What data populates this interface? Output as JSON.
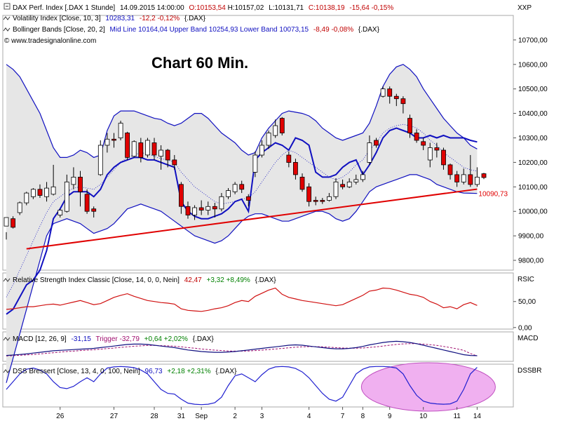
{
  "header": {
    "line1": {
      "icon": "minus-box-icon",
      "name": "DAX Perf. Index [.DAX  1 Stunde]",
      "datetime": "14.09.2015 14:00:00",
      "open": "O:10153,54",
      "high": "H:10157,02",
      "low": "L:10131,71",
      "close": "C:10138,19",
      "change": "-15,64 -0,15%"
    },
    "line2": {
      "icon": "indicator-icon",
      "name": "Volatility Index [Close, 10, 3]",
      "value": "10283,31",
      "change": "-12,2 -0,12%",
      "symbol": "{.DAX}"
    },
    "line3": {
      "icon": "indicator-icon",
      "name": "Bollinger Bands [Close, 20, 2]",
      "bands": "Mid Line 10164,04 Upper Band 10254,93 Lower Band 10073,15",
      "change": "-8,49 -0,08%",
      "symbol": "{.DAX}"
    },
    "copyright": "© www.tradesignalonline.com"
  },
  "chart_title": "Chart 60 Min.",
  "colors": {
    "up_candle": "#ffffff",
    "down_candle": "#e00000",
    "bollinger_line": "#1010c0",
    "band_fill": "#e6e6e6",
    "trendline": "#e00000",
    "rsi": "#d01010",
    "macd": "#101080",
    "trigger": "#a01070",
    "dss": "#2020d0",
    "highlight": "#f0b0f0"
  },
  "chart_data": [
    {
      "type": "candlestick",
      "axis_label": "XXP",
      "y_ticks": [
        "9800,00",
        "9900,00",
        "10000,00",
        "10100,00",
        "10200,00",
        "10300,00",
        "10400,00",
        "10500,00",
        "10600,00",
        "10700,00"
      ],
      "ylim": [
        9760,
        10800
      ],
      "x_labels": [
        "26",
        "27",
        "28",
        "31",
        "Sep",
        "2",
        "3",
        "4",
        "7",
        "8",
        "9",
        "10",
        "11",
        "14"
      ],
      "candles": [
        [
          9940,
          9975,
          9915,
          9885
        ],
        [
          9970,
          9935,
          9980,
          9930
        ],
        [
          9995,
          10035,
          10040,
          9985
        ],
        [
          10035,
          10075,
          10080,
          10025
        ],
        [
          10060,
          10090,
          10095,
          10050
        ],
        [
          10090,
          10065,
          10110,
          10055
        ],
        [
          10060,
          10095,
          10120,
          10040
        ],
        [
          10070,
          10100,
          10190,
          10065
        ],
        [
          9985,
          10005,
          10010,
          9975
        ],
        [
          10000,
          10120,
          10150,
          9995
        ],
        [
          10110,
          10140,
          10180,
          10090
        ],
        [
          10140,
          10080,
          10165,
          10020
        ],
        [
          10070,
          10000,
          10090,
          9990
        ],
        [
          10010,
          10000,
          10020,
          9975
        ],
        [
          10150,
          10270,
          10290,
          10145
        ],
        [
          10270,
          10295,
          10320,
          10240
        ],
        [
          10295,
          10290,
          10320,
          10260
        ],
        [
          10300,
          10360,
          10370,
          10290
        ],
        [
          10320,
          10220,
          10325,
          10210
        ],
        [
          10225,
          10285,
          10290,
          10220
        ],
        [
          10280,
          10220,
          10300,
          10200
        ],
        [
          10230,
          10290,
          10300,
          10220
        ],
        [
          10280,
          10230,
          10300,
          10210
        ],
        [
          10225,
          10250,
          10270,
          10170
        ],
        [
          10250,
          10210,
          10255,
          10180
        ],
        [
          10210,
          10190,
          10230,
          10170
        ],
        [
          10110,
          10020,
          10120,
          9990
        ],
        [
          10020,
          9985,
          10040,
          9970
        ],
        [
          9985,
          10015,
          10025,
          9965
        ],
        [
          10015,
          10005,
          10045,
          9985
        ],
        [
          10005,
          10020,
          10040,
          9985
        ],
        [
          10020,
          10010,
          10035,
          9975
        ],
        [
          10010,
          10060,
          10075,
          10000
        ],
        [
          10060,
          10085,
          10095,
          10050
        ],
        [
          10080,
          10110,
          10120,
          10070
        ],
        [
          10110,
          10090,
          10125,
          10075
        ],
        [
          10060,
          10045,
          10070,
          10020
        ],
        [
          10160,
          10230,
          10245,
          10140
        ],
        [
          10230,
          10270,
          10290,
          10220
        ],
        [
          10270,
          10320,
          10330,
          10255
        ],
        [
          10310,
          10350,
          10375,
          10300
        ],
        [
          10380,
          10320,
          10385,
          10310
        ],
        [
          10230,
          10200,
          10245,
          10180
        ],
        [
          10200,
          10150,
          10215,
          10130
        ],
        [
          10140,
          10090,
          10155,
          10080
        ],
        [
          10100,
          10040,
          10115,
          10020
        ],
        [
          10045,
          10040,
          10060,
          10025
        ],
        [
          10045,
          10040,
          10055,
          10030
        ],
        [
          10045,
          10060,
          10075,
          10040
        ],
        [
          10060,
          10120,
          10135,
          10050
        ],
        [
          10110,
          10100,
          10130,
          10090
        ],
        [
          10100,
          10120,
          10135,
          10095
        ],
        [
          10120,
          10130,
          10150,
          10110
        ],
        [
          10130,
          10150,
          10165,
          10120
        ],
        [
          10200,
          10280,
          10310,
          10190
        ],
        [
          10290,
          10270,
          10300,
          10260
        ],
        [
          10470,
          10500,
          10510,
          10465
        ],
        [
          10500,
          10470,
          10510,
          10440
        ],
        [
          10470,
          10460,
          10480,
          10430
        ],
        [
          10460,
          10440,
          10470,
          10400
        ],
        [
          10380,
          10320,
          10395,
          10300
        ],
        [
          10320,
          10290,
          10335,
          10280
        ],
        [
          10285,
          10270,
          10300,
          10250
        ],
        [
          10210,
          10260,
          10280,
          10180
        ],
        [
          10260,
          10250,
          10280,
          10220
        ],
        [
          10250,
          10190,
          10260,
          10170
        ],
        [
          10190,
          10150,
          10195,
          10130
        ],
        [
          10150,
          10120,
          10165,
          10100
        ],
        [
          10120,
          10150,
          10175,
          10110
        ],
        [
          10150,
          10110,
          10230,
          10100
        ],
        [
          10110,
          10140,
          10180,
          10100
        ],
        [
          10153.54,
          10138.19,
          10157.02,
          10131.71
        ]
      ],
      "trendline": {
        "from": [
          3,
          9847
        ],
        "to": [
          70,
          10090.73
        ],
        "label": "10090,73"
      },
      "bollinger": {
        "mid": [
          9650,
          9700,
          9760,
          9820,
          9880,
          9940,
          9995,
          10040,
          10060,
          10080,
          10095,
          10100,
          10095,
          10090,
          10110,
          10140,
          10170,
          10200,
          10220,
          10230,
          10240,
          10235,
          10225,
          10215,
          10210,
          10200,
          10160,
          10130,
          10100,
          10080,
          10060,
          10040,
          10030,
          10035,
          10040,
          10050,
          10055,
          10080,
          10120,
          10160,
          10200,
          10230,
          10250,
          10240,
          10220,
          10200,
          10180,
          10160,
          10140,
          10130,
          10140,
          10160,
          10190,
          10210,
          10250,
          10280,
          10320,
          10340,
          10350,
          10355,
          10350,
          10340,
          10320,
          10290,
          10270,
          10240,
          10220,
          10200,
          10180,
          10170,
          10164
        ],
        "upper": [
          10600,
          10580,
          10550,
          10500,
          10450,
          10400,
          10330,
          10260,
          10220,
          10220,
          10230,
          10250,
          10240,
          10220,
          10230,
          10330,
          10390,
          10410,
          10410,
          10410,
          10400,
          10390,
          10380,
          10375,
          10360,
          10350,
          10360,
          10380,
          10400,
          10400,
          10380,
          10350,
          10320,
          10300,
          10280,
          10250,
          10230,
          10240,
          10300,
          10340,
          10370,
          10400,
          10410,
          10405,
          10400,
          10390,
          10370,
          10340,
          10320,
          10300,
          10290,
          10300,
          10310,
          10320,
          10360,
          10430,
          10510,
          10560,
          10590,
          10600,
          10580,
          10550,
          10500,
          10460,
          10420,
          10380,
          10350,
          10320,
          10300,
          10270,
          10254.93
        ],
        "lower": [
          9300,
          9400,
          9500,
          9600,
          9700,
          9800,
          9900,
          9950,
          9960,
          9970,
          9960,
          9950,
          9930,
          9910,
          9920,
          9930,
          9950,
          9980,
          10010,
          10020,
          10030,
          10020,
          10010,
          10000,
          9980,
          9960,
          9940,
          9920,
          9900,
          9890,
          9880,
          9870,
          9880,
          9900,
          9930,
          9960,
          9980,
          9990,
          9990,
          9980,
          9970,
          9960,
          9960,
          9970,
          9980,
          9990,
          10000,
          10000,
          9990,
          9970,
          9960,
          9970,
          10000,
          10040,
          10080,
          10100,
          10110,
          10120,
          10130,
          10140,
          10150,
          10150,
          10140,
          10130,
          10110,
          10100,
          10090,
          10080,
          10075,
          10074,
          10073.15
        ]
      },
      "volatility_index": [
        9580,
        9600,
        9650,
        9700,
        9720,
        9760,
        9840,
        9970,
        10010,
        10060,
        10080,
        10080,
        10080,
        10060,
        10090,
        10150,
        10180,
        10200,
        10210,
        10220,
        10220,
        10210,
        10210,
        10200,
        10190,
        10180,
        10040,
        10000,
        9980,
        9970,
        9970,
        9980,
        9990,
        10010,
        10040,
        10050,
        10000,
        10210,
        10240,
        10260,
        10280,
        10270,
        10250,
        10300,
        10290,
        10270,
        10160,
        10140,
        10140,
        10150,
        10180,
        10200,
        10210,
        10150,
        10190,
        10240,
        10300,
        10330,
        10340,
        10330,
        10320,
        10300,
        10300,
        10310,
        10300,
        10310,
        10300,
        10300,
        10300,
        10290,
        10283.31
      ]
    },
    {
      "type": "line",
      "name": "Relative Strength Index Classic [Close, 14, 0, 0, Nein]",
      "value": "42,47",
      "change": "+3,32 +8,49%",
      "symbol": "{.DAX}",
      "axis_label": "RSIC",
      "y_ticks": [
        "0,00",
        "50,00"
      ],
      "ylim": [
        -3,
        105
      ],
      "values": [
        35,
        36,
        38,
        40,
        40,
        42,
        44,
        45,
        43,
        46,
        49,
        52,
        48,
        44,
        46,
        52,
        58,
        62,
        65,
        60,
        56,
        52,
        50,
        48,
        47,
        45,
        36,
        33,
        32,
        31,
        33,
        36,
        38,
        42,
        48,
        52,
        50,
        60,
        66,
        72,
        76,
        64,
        58,
        55,
        52,
        50,
        48,
        46,
        44,
        42,
        44,
        50,
        56,
        62,
        70,
        72,
        76,
        75,
        72,
        68,
        64,
        62,
        58,
        50,
        45,
        38,
        40,
        36,
        44,
        48,
        42.47
      ]
    },
    {
      "type": "line",
      "name": "MACD [12, 26, 9]",
      "value": "-31,15",
      "trigger": "Trigger -32,79",
      "change": "+0,64 +2,02%",
      "symbol": "{.DAX}",
      "axis_label": "MACD",
      "ylim": [
        -60,
        90
      ],
      "series": [
        {
          "name": "MACD",
          "values": [
            -30,
            -28,
            -25,
            -22,
            -18,
            -14,
            -10,
            -6,
            -4,
            -2,
            0,
            2,
            4,
            6,
            10,
            14,
            18,
            22,
            26,
            28,
            28,
            26,
            22,
            18,
            14,
            10,
            4,
            -2,
            -6,
            -10,
            -12,
            -14,
            -14,
            -12,
            -10,
            -6,
            -2,
            2,
            6,
            10,
            14,
            18,
            22,
            24,
            22,
            18,
            14,
            10,
            6,
            4,
            4,
            6,
            10,
            16,
            24,
            30,
            36,
            40,
            42,
            40,
            36,
            30,
            22,
            14,
            6,
            -2,
            -10,
            -18,
            -26,
            -30,
            -31.15
          ]
        },
        {
          "name": "Trigger",
          "values": [
            -32,
            -31,
            -29,
            -27,
            -25,
            -22,
            -19,
            -16,
            -13,
            -10,
            -8,
            -5,
            -3,
            -1,
            2,
            5,
            8,
            11,
            14,
            17,
            19,
            21,
            21,
            20,
            19,
            17,
            14,
            10,
            7,
            3,
            0,
            -3,
            -5,
            -7,
            -8,
            -8,
            -7,
            -5,
            -3,
            0,
            3,
            6,
            9,
            12,
            14,
            15,
            15,
            14,
            12,
            10,
            8,
            7,
            7,
            8,
            11,
            14,
            18,
            22,
            26,
            29,
            30,
            30,
            28,
            25,
            21,
            16,
            10,
            4,
            -4,
            -20,
            -32.79
          ]
        }
      ]
    },
    {
      "type": "line",
      "name": "DSS Bressert [Close, 13, 4, 0, 100, Nein]",
      "value": "96,73",
      "change": "+2,18 +2,31%",
      "symbol": "{.DAX}",
      "axis_label": "DSSBR",
      "ylim": [
        -5,
        105
      ],
      "values": [
        40,
        60,
        80,
        92,
        95,
        90,
        80,
        60,
        45,
        42,
        48,
        60,
        70,
        60,
        80,
        95,
        98,
        99,
        98,
        96,
        90,
        80,
        60,
        40,
        30,
        28,
        15,
        5,
        2,
        1,
        2,
        6,
        20,
        50,
        75,
        80,
        70,
        60,
        78,
        92,
        98,
        99,
        98,
        94,
        85,
        70,
        50,
        30,
        15,
        10,
        20,
        50,
        80,
        92,
        98,
        99,
        99,
        98,
        95,
        80,
        50,
        25,
        10,
        5,
        3,
        2,
        3,
        10,
        40,
        80,
        96.73
      ]
    }
  ]
}
